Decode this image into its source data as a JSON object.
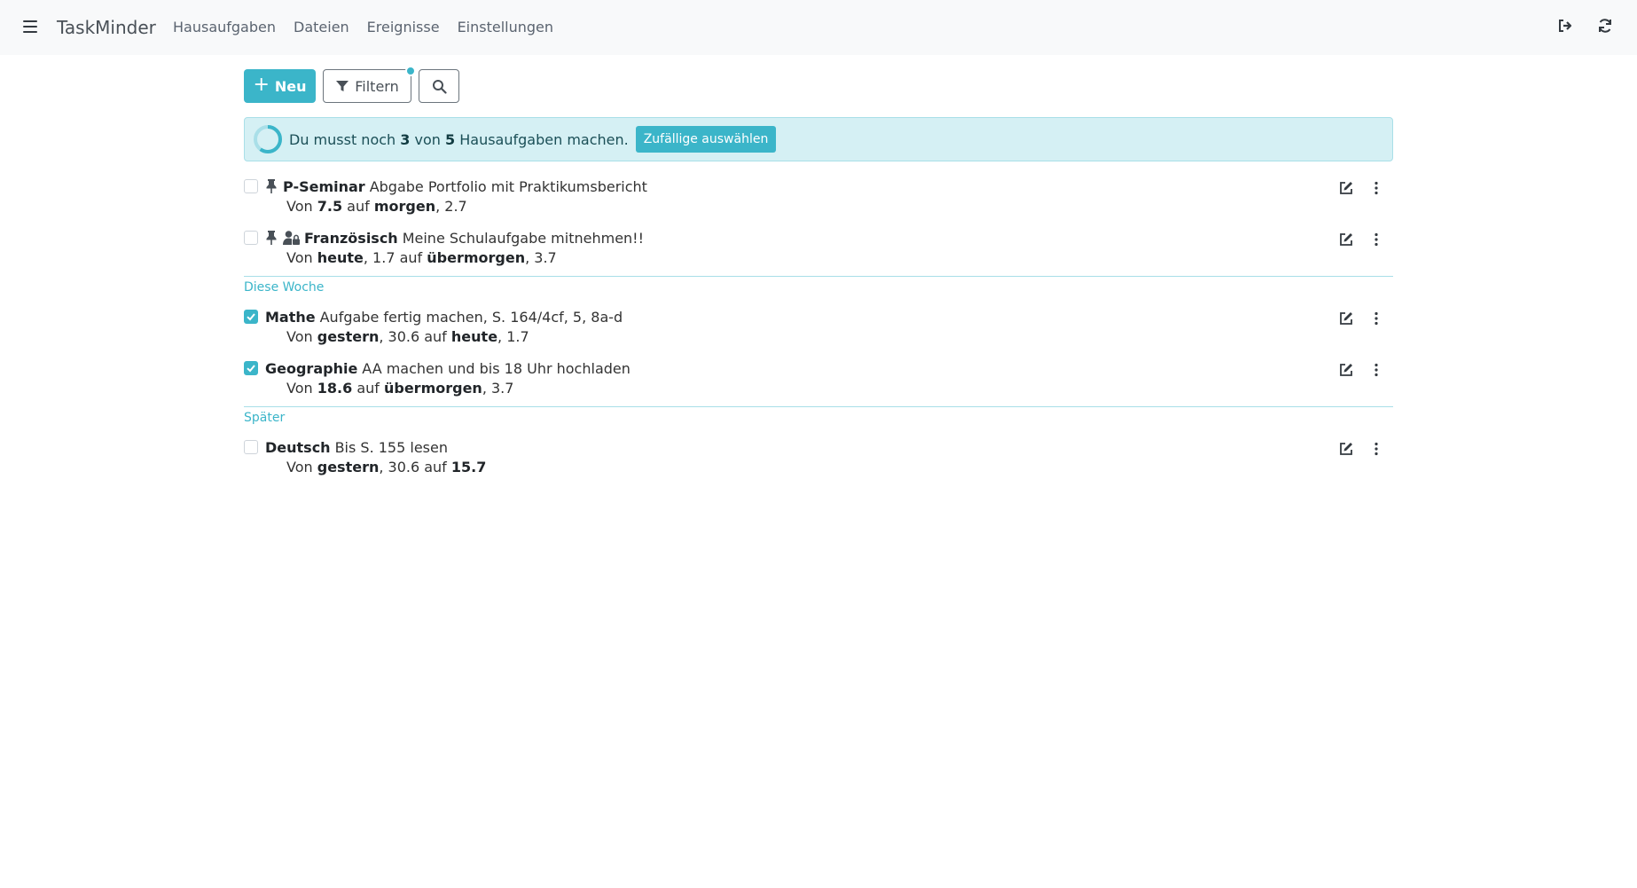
{
  "app": {
    "brand": "TaskMinder",
    "nav": [
      "Hausaufgaben",
      "Dateien",
      "Ereignisse",
      "Einstellungen"
    ]
  },
  "toolbar": {
    "new_label": "Neu",
    "filter_label": "Filtern"
  },
  "alert": {
    "prefix": "Du musst noch",
    "remaining": "3",
    "mid": "von",
    "total": "5",
    "suffix": "Hausaufgaben machen.",
    "random_label": "Zufällige auswählen",
    "progress_fraction": 0.4
  },
  "colors": {
    "accent": "#3bb5c9",
    "alert_bg": "#d5f0f4"
  },
  "tasks_pinned": [
    {
      "subject": "P-Seminar",
      "description": "Abgabe Portfolio mit Praktikumsbericht",
      "von_label": "Von",
      "from": "7.5",
      "auf_label": "auf",
      "to": "morgen",
      "to_date": ", 2.7",
      "checked": false,
      "icons": [
        "pin-icon"
      ]
    },
    {
      "subject": "Französisch",
      "description": "Meine Schulaufgabe mitnehmen!!",
      "von_label": "Von",
      "from": "heute",
      "from_date": ", 1.7",
      "auf_label": "auf",
      "to": "übermorgen",
      "to_date": ", 3.7",
      "checked": false,
      "icons": [
        "pin-icon",
        "user-lock-icon"
      ]
    }
  ],
  "sections": [
    {
      "label": "Diese Woche",
      "tasks": [
        {
          "subject": "Mathe",
          "description": "Aufgabe fertig machen, S. 164/4cf, 5, 8a-d",
          "von_label": "Von",
          "from": "gestern",
          "from_date": ", 30.6",
          "auf_label": "auf",
          "to": "heute",
          "to_date": ", 1.7",
          "checked": true
        },
        {
          "subject": "Geographie",
          "description": "AA machen und bis 18 Uhr hochladen",
          "von_label": "Von",
          "from": "18.6",
          "auf_label": "auf",
          "to": "übermorgen",
          "to_date": ", 3.7",
          "checked": true
        }
      ]
    },
    {
      "label": "Später",
      "tasks": [
        {
          "subject": "Deutsch",
          "description": "Bis S. 155 lesen",
          "von_label": "Von",
          "from": "gestern",
          "from_date": ", 30.6",
          "auf_label": "auf",
          "to": "15.7",
          "checked": false
        }
      ]
    }
  ]
}
